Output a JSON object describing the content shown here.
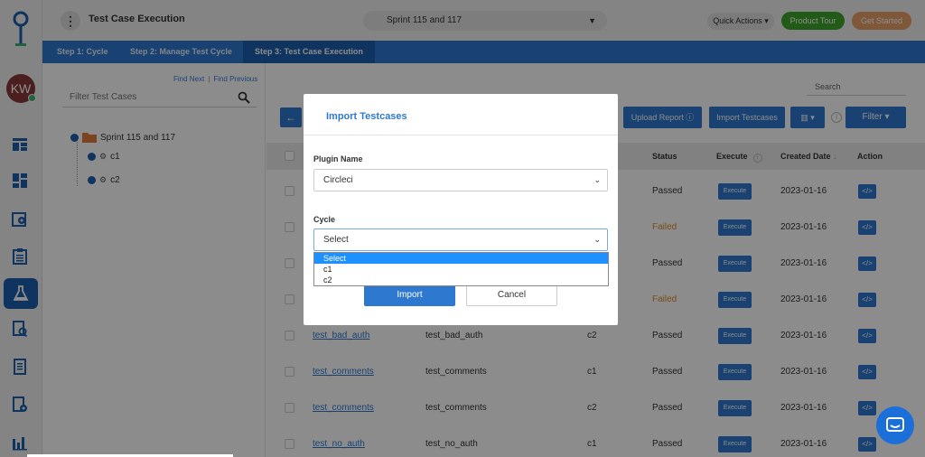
{
  "header": {
    "title": "Test Case Execution",
    "sprint": "Sprint 115 and 117",
    "quick_actions": "Quick Actions",
    "product_tour": "Product Tour",
    "get_started": "Get Started"
  },
  "sidebar": {
    "avatar_initials": "KW",
    "icons": [
      "dashboard-icon",
      "widgets-icon",
      "settings-gear-icon",
      "clipboard-list-icon",
      "flask-icon",
      "search-report-icon",
      "document-icon",
      "report-settings-icon",
      "bar-chart-icon"
    ],
    "active_icon": "flask-icon"
  },
  "steps": [
    {
      "label": "Step 1: Cycle"
    },
    {
      "label": "Step 2: Manage Test Cycle"
    },
    {
      "label": "Step 3: Test Case Execution"
    }
  ],
  "left_panel": {
    "find_next": "Find Next",
    "find_previous": "Find Previous",
    "filter_placeholder": "Filter Test Cases",
    "tree_root": "Sprint 115 and 117",
    "tree_children": [
      "c1",
      "c2"
    ]
  },
  "toolbar": {
    "search_placeholder": "Search",
    "upload_report": "Upload Report",
    "import_testcases": "Import Testcases",
    "filter": "Filter"
  },
  "table": {
    "headers": {
      "status": "Status",
      "execute": "Execute",
      "created_date": "Created Date",
      "action": "Action"
    },
    "rows": [
      {
        "name": "",
        "key": "",
        "cycle": "",
        "status": "Passed",
        "execute": "Execute",
        "date": "2023-01-16"
      },
      {
        "name": "",
        "key": "",
        "cycle": "",
        "status": "Failed",
        "execute": "Execute",
        "date": "2023-01-16"
      },
      {
        "name": "",
        "key": "",
        "cycle": "",
        "status": "Passed",
        "execute": "Execute",
        "date": "2023-01-16"
      },
      {
        "name": "",
        "key": "",
        "cycle": "",
        "status": "Failed",
        "execute": "Execute",
        "date": "2023-01-16"
      },
      {
        "name": "test_bad_auth",
        "key": "test_bad_auth",
        "cycle": "c2",
        "status": "Passed",
        "execute": "Execute",
        "date": "2023-01-16"
      },
      {
        "name": "test_comments",
        "key": "test_comments",
        "cycle": "c1",
        "status": "Passed",
        "execute": "Execute",
        "date": "2023-01-16"
      },
      {
        "name": "test_comments",
        "key": "test_comments",
        "cycle": "c2",
        "status": "Passed",
        "execute": "Execute",
        "date": "2023-01-16"
      },
      {
        "name": "test_no_auth",
        "key": "test_no_auth",
        "cycle": "c1",
        "status": "Passed",
        "execute": "Execute",
        "date": "2023-01-16"
      }
    ]
  },
  "modal": {
    "title": "Import Testcases",
    "plugin_label": "Plugin Name",
    "plugin_value": "Circleci",
    "cycle_label": "Cycle",
    "cycle_value": "Select",
    "cycle_options": [
      "Select",
      "c1",
      "c2"
    ],
    "import_label": "Import",
    "cancel_label": "Cancel"
  },
  "colors": {
    "primary": "#2f78cf",
    "active_step": "#1d5fae",
    "failed": "#d98b2b",
    "tour_green": "#3ea62a",
    "start_orange": "#e8a06a"
  }
}
